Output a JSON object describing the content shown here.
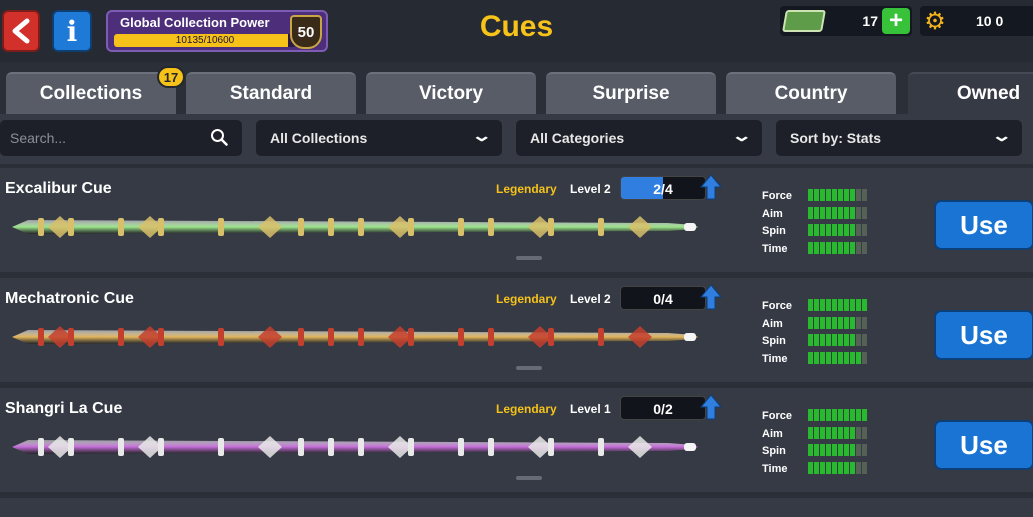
{
  "header": {
    "title": "Cues",
    "collection_power": {
      "label": "Global Collection Power",
      "progress_text": "10135/10600",
      "progress_fraction": 0.956,
      "level": "50"
    },
    "cash": "17",
    "coins": "10 0"
  },
  "tabs": [
    {
      "label": "Collections",
      "badge": "17"
    },
    {
      "label": "Standard"
    },
    {
      "label": "Victory"
    },
    {
      "label": "Surprise"
    },
    {
      "label": "Country"
    },
    {
      "label": "Owned",
      "active": true
    }
  ],
  "filters": {
    "search_placeholder": "Search...",
    "collections": "All Collections",
    "categories": "All Categories",
    "sort": "Sort by: Stats"
  },
  "cues": [
    {
      "name": "Excalibur Cue",
      "rarity": "Legendary",
      "level": "Level 2",
      "progress": "2/4",
      "progress_fraction": 0.5,
      "color_main": "#9be48a",
      "color_accent": "#d8c06a",
      "stats": {
        "force": 8,
        "aim": 8,
        "spin": 8,
        "time": 8
      },
      "max_segments": 10,
      "use_label": "Use"
    },
    {
      "name": "Mechatronic Cue",
      "rarity": "Legendary",
      "level": "Level 2",
      "progress": "0/4",
      "progress_fraction": 0,
      "color_main": "#e0b45a",
      "color_accent": "#c4402e",
      "stats": {
        "force": 10,
        "aim": 8,
        "spin": 8,
        "time": 9
      },
      "max_segments": 10,
      "use_label": "Use"
    },
    {
      "name": "Shangri La Cue",
      "rarity": "Legendary",
      "level": "Level 1",
      "progress": "0/2",
      "progress_fraction": 0,
      "color_main": "#c46ad8",
      "color_accent": "#e8e8e8",
      "stats": {
        "force": 10,
        "aim": 8,
        "spin": 8,
        "time": 8
      },
      "max_segments": 10,
      "use_label": "Use"
    }
  ],
  "stat_labels": {
    "force": "Force",
    "aim": "Aim",
    "spin": "Spin",
    "time": "Time"
  }
}
